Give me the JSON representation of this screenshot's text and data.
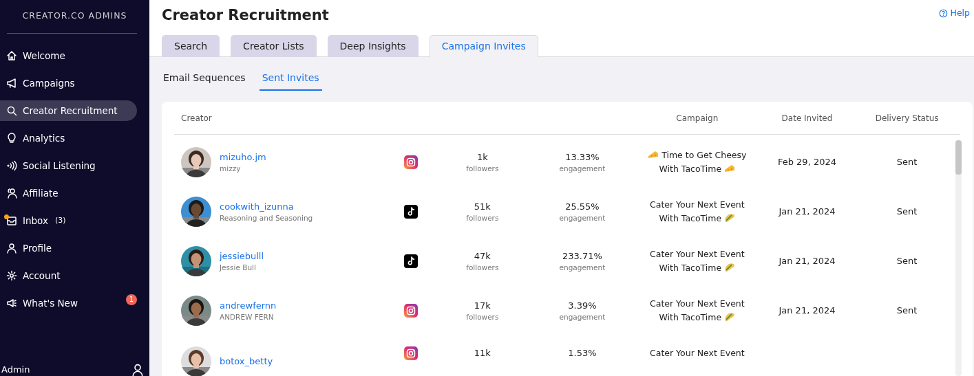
{
  "sidebar": {
    "brand": "CREATOR.CO ADMINS",
    "items": [
      {
        "label": "Welcome",
        "selected": false
      },
      {
        "label": "Campaigns",
        "selected": false
      },
      {
        "label": "Creator Recruitment",
        "selected": true
      },
      {
        "label": "Analytics",
        "selected": false
      },
      {
        "label": "Social Listening",
        "selected": false
      },
      {
        "label": "Affiliate",
        "selected": false
      },
      {
        "label": "Inbox",
        "selected": false,
        "count": "(3)",
        "dot": true
      },
      {
        "label": "Profile",
        "selected": false
      },
      {
        "label": "Account",
        "selected": false
      },
      {
        "label": "What's New",
        "selected": false,
        "badge": "1"
      }
    ],
    "footer": "Admin"
  },
  "page": {
    "title": "Creator Recruitment",
    "help": "Help"
  },
  "tabs": [
    {
      "label": "Search",
      "selected": false
    },
    {
      "label": "Creator Lists",
      "selected": false
    },
    {
      "label": "Deep Insights",
      "selected": false
    },
    {
      "label": "Campaign Invites",
      "selected": true
    }
  ],
  "subtabs": [
    {
      "label": "Email Sequences",
      "selected": false
    },
    {
      "label": "Sent Invites",
      "selected": true
    }
  ],
  "table": {
    "columns": [
      "Creator",
      "Campaign",
      "Date Invited",
      "Delivery Status"
    ],
    "rows": [
      {
        "handle": "mizuho.jm",
        "name": "mizzy",
        "platform": {
          "kind": "instagram"
        },
        "followers": "1k",
        "followers_label": "followers",
        "engagement": "13.33%",
        "engagement_label": "engagement",
        "campaign": {
          "kind": "cheese",
          "lines": [
            "Time to Get Cheesy",
            "With TacoTime"
          ]
        },
        "date": "Feb 29, 2024",
        "status": "Sent"
      },
      {
        "handle": "cookwith_izunna",
        "name": "Reasoning and Seasoning",
        "platform": {
          "kind": "tiktok"
        },
        "followers": "51k",
        "followers_label": "followers",
        "engagement": "25.55%",
        "engagement_label": "engagement",
        "campaign": {
          "kind": "taco",
          "lines": [
            "Cater Your Next Event",
            "With TacoTime"
          ]
        },
        "date": "Jan 21, 2024",
        "status": "Sent"
      },
      {
        "handle": "jessiebulll",
        "name": "Jessie Bull",
        "platform": {
          "kind": "tiktok"
        },
        "followers": "47k",
        "followers_label": "followers",
        "engagement": "233.71%",
        "engagement_label": "engagement",
        "campaign": {
          "kind": "taco",
          "lines": [
            "Cater Your Next Event",
            "With TacoTime"
          ]
        },
        "date": "Jan 21, 2024",
        "status": "Sent"
      },
      {
        "handle": "andrewfernn",
        "name": "ANDREW FERN",
        "platform": {
          "kind": "instagram"
        },
        "followers": "17k",
        "followers_label": "followers",
        "engagement": "3.39%",
        "engagement_label": "engagement",
        "campaign": {
          "kind": "taco",
          "lines": [
            "Cater Your Next Event",
            "With TacoTime"
          ]
        },
        "date": "Jan 21, 2024",
        "status": "Sent"
      },
      {
        "handle": "botox_betty",
        "platform": {
          "kind": "instagram"
        },
        "followers": "11k",
        "engagement": "1.53%",
        "campaign": {
          "lines": [
            "Cater Your Next Event"
          ]
        }
      }
    ]
  }
}
